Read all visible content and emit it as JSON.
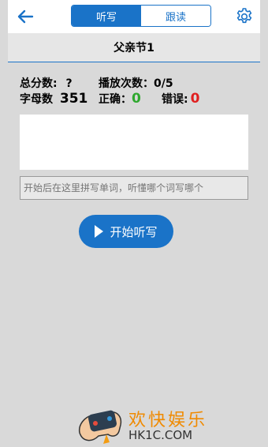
{
  "header": {
    "tabs": [
      {
        "label": "听写",
        "active": true
      },
      {
        "label": "跟读",
        "active": false
      }
    ]
  },
  "title": "父亲节1",
  "stats": {
    "total_score_label": "总分数:",
    "total_score_value": "?",
    "play_count_label": "播放次数：",
    "play_count_value": "0/5",
    "letter_count_label": "字母数",
    "letter_count_value": "351",
    "correct_label": "正确：",
    "correct_value": "0",
    "wrong_label": "错误:",
    "wrong_value": "0"
  },
  "input": {
    "placeholder": "开始后在这里拼写单词，听懂哪个词写哪个"
  },
  "start_button": {
    "label": "开始听写"
  },
  "watermark": {
    "line1": "欢快娱乐",
    "line2": "HK1C.COM"
  },
  "colors": {
    "accent": "#1a73c8",
    "correct": "#2ea82e",
    "wrong": "#e02020"
  }
}
